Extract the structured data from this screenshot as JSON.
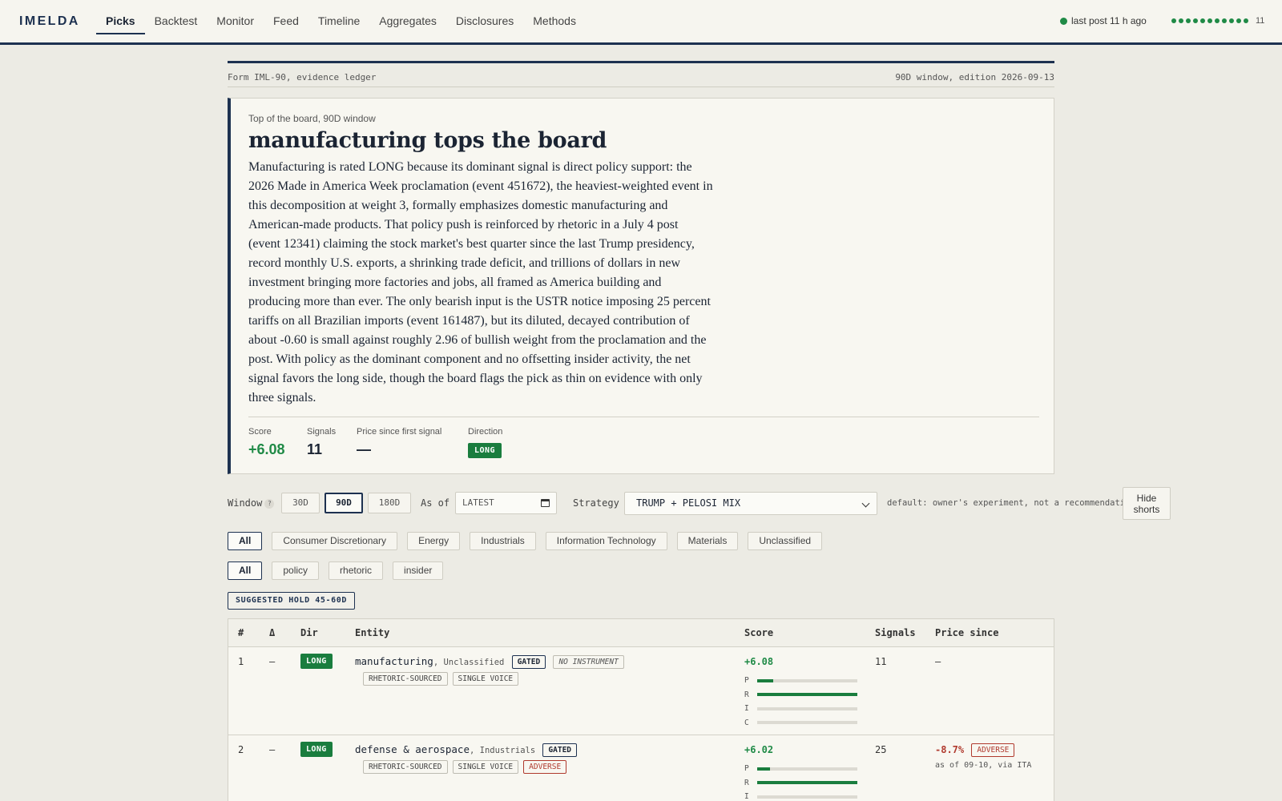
{
  "nav": {
    "brand": "IMELDA",
    "tabs": [
      {
        "label": "Picks",
        "active": true
      },
      {
        "label": "Backtest"
      },
      {
        "label": "Monitor"
      },
      {
        "label": "Feed"
      },
      {
        "label": "Timeline"
      },
      {
        "label": "Aggregates"
      },
      {
        "label": "Disclosures"
      },
      {
        "label": "Methods"
      }
    ],
    "status_text": "last post 11 h ago",
    "pip_count": "11"
  },
  "ledger": {
    "form": "Form IML-90, evidence ledger",
    "edition": "90D window, edition 2026-09-13"
  },
  "hero": {
    "eyebrow": "Top of the board, 90D window",
    "title": "manufacturing tops the board",
    "body": "Manufacturing is rated LONG because its dominant signal is direct policy support: the 2026 Made in America Week proclamation (event 451672), the heaviest-weighted event in this decomposition at weight 3, formally emphasizes domestic manufacturing and American-made products. That policy push is reinforced by rhetoric in a July 4 post (event 12341) claiming the stock market's best quarter since the last Trump presidency, record monthly U.S. exports, a shrinking trade deficit, and trillions of dollars in new investment bringing more factories and jobs, all framed as America building and producing more than ever. The only bearish input is the USTR notice imposing 25 percent tariffs on all Brazilian imports (event 161487), but its diluted, decayed contribution of about -0.60 is small against roughly 2.96 of bullish weight from the proclamation and the post. With policy as the dominant component and no offsetting insider activity, the net signal favors the long side, though the board flags the pick as thin on evidence with only three signals.",
    "stats": {
      "score_label": "Score",
      "score_value": "+6.08",
      "signals_label": "Signals",
      "signals_value": "11",
      "price_label": "Price since first signal",
      "price_value": "—",
      "direction_label": "Direction",
      "direction_value": "LONG"
    }
  },
  "controls": {
    "window_label": "Window",
    "help_glyph": "?",
    "windows": [
      "30D",
      "90D",
      "180D"
    ],
    "active_window": "90D",
    "asof_label": "As of",
    "asof_value": "LATEST",
    "strategy_label": "Strategy",
    "strategy_value": "TRUMP + PELOSI MIX",
    "strategy_hint": "default: owner's experiment, not a recommendation",
    "hide_shorts_label": "Hide shorts"
  },
  "sectors": [
    "All",
    "Consumer Discretionary",
    "Energy",
    "Industrials",
    "Information Technology",
    "Materials",
    "Unclassified"
  ],
  "signal_types": [
    "All",
    "policy",
    "rhetoric",
    "insider"
  ],
  "hold_tag": "SUGGESTED HOLD 45-60D",
  "table": {
    "headers": {
      "rank": "#",
      "delta": "Δ",
      "dir": "Dir",
      "entity": "Entity",
      "score": "Score",
      "signals": "Signals",
      "price": "Price since"
    },
    "bar_labels": [
      "P",
      "R",
      "I",
      "C"
    ],
    "rows": [
      {
        "rank": "1",
        "delta": "—",
        "dir": "LONG",
        "entity": "manufacturing",
        "sector": ", Unclassified",
        "tags_inline": [
          "GATED",
          "NO INSTRUMENT"
        ],
        "tags_line2": [
          "RHETORIC-SOURCED",
          "SINGLE VOICE"
        ],
        "score": "+6.08",
        "components": {
          "P": 0.16,
          "R": 1.0,
          "I": 0.0,
          "C": 0.0
        },
        "signals": "11",
        "price": "—"
      },
      {
        "rank": "2",
        "delta": "—",
        "dir": "LONG",
        "entity": "defense & aerospace",
        "sector": ", Industrials",
        "tags_inline": [
          "GATED"
        ],
        "tags_line2": [
          "RHETORIC-SOURCED",
          "SINGLE VOICE",
          "ADVERSE"
        ],
        "score": "+6.02",
        "components": {
          "P": 0.13,
          "R": 1.0,
          "I": 0.0,
          "C": 0.0
        },
        "signals": "25",
        "price": "-8.7%",
        "price_tag": "ADVERSE",
        "price_asof": "as of 09-10, via ITA"
      }
    ]
  },
  "colors": {
    "accent": "#1d3150",
    "long": "#1a7d3e",
    "adverse": "#b03a2e",
    "bg": "#ecebe4",
    "card": "#f8f7f1"
  }
}
